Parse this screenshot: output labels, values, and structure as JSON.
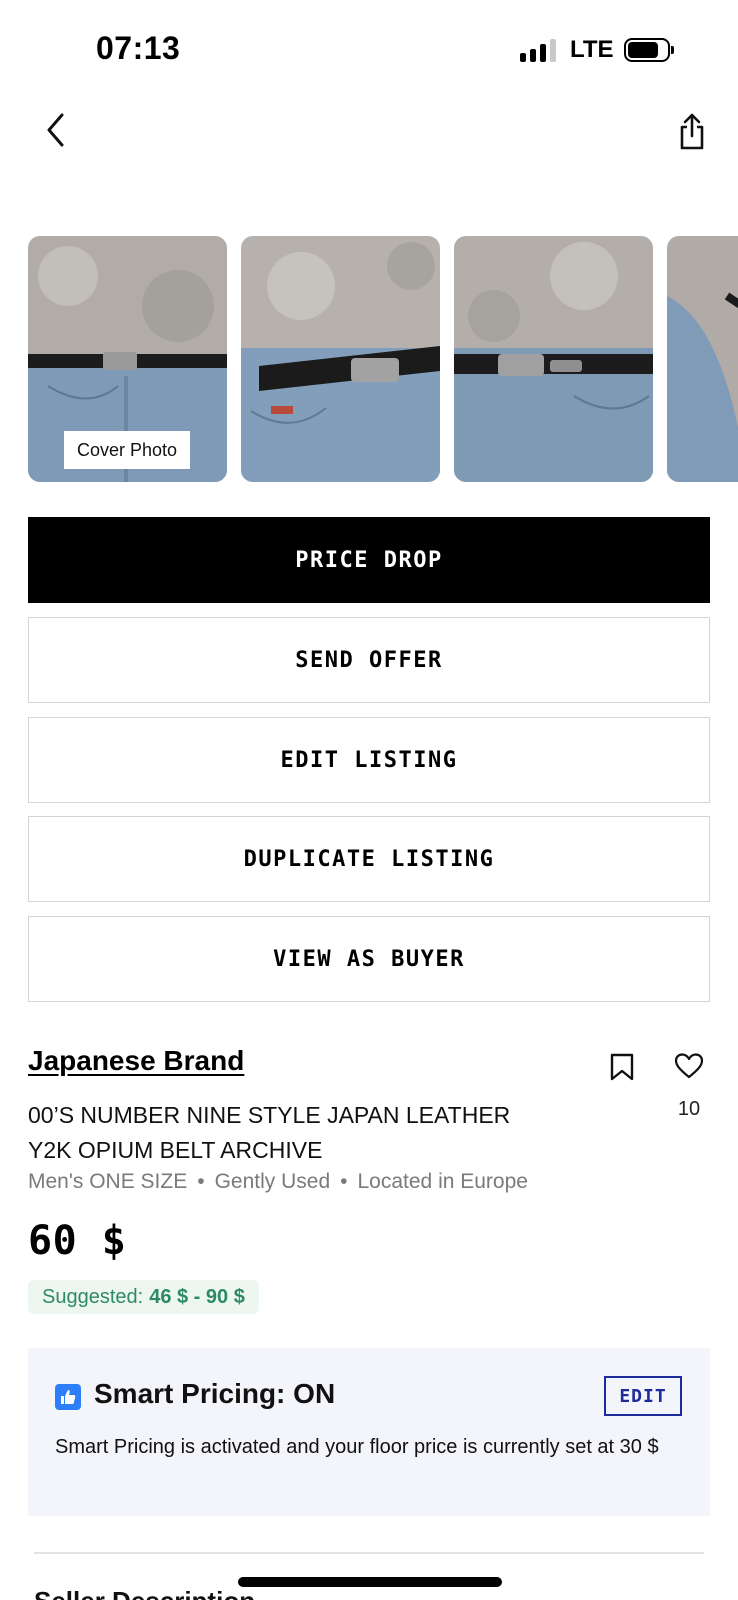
{
  "status_bar": {
    "time": "07:13",
    "network": "LTE"
  },
  "photos": {
    "cover_label": "Cover Photo",
    "count_visible": 4
  },
  "actions": {
    "price_drop": "PRICE DROP",
    "send_offer": "SEND OFFER",
    "edit_listing": "EDIT LISTING",
    "duplicate_listing": "DUPLICATE LISTING",
    "view_as_buyer": "VIEW AS BUYER"
  },
  "listing": {
    "brand": "Japanese Brand",
    "title_line1": "00’S NUMBER NINE STYLE JAPAN LEATHER",
    "title_line2": "Y2K OPIUM BELT ARCHIVE",
    "size": "Men's ONE SIZE",
    "condition": "Gently Used",
    "location": "Located in Europe",
    "likes": "10",
    "price": "60 $",
    "suggested_label": "Suggested:",
    "suggested_range": "46 $ - 90 $"
  },
  "smart_pricing": {
    "title": "Smart Pricing: ON",
    "edit_label": "EDIT",
    "description": "Smart Pricing is activated and your floor price is currently set at 30 $"
  },
  "seller_section": {
    "heading": "Seller Description"
  },
  "colors": {
    "primary_button": "#000000",
    "suggested_green": "#2e8a63",
    "edit_blue": "#1f2a9c",
    "smart_card_bg": "#f4f5fb",
    "thumb_icon_blue": "#2d7ff9"
  },
  "icons": {
    "back": "chevron-left-icon",
    "share": "share-icon",
    "bookmark": "bookmark-icon",
    "like": "heart-icon",
    "smart_pricing": "thumbs-up-icon"
  }
}
